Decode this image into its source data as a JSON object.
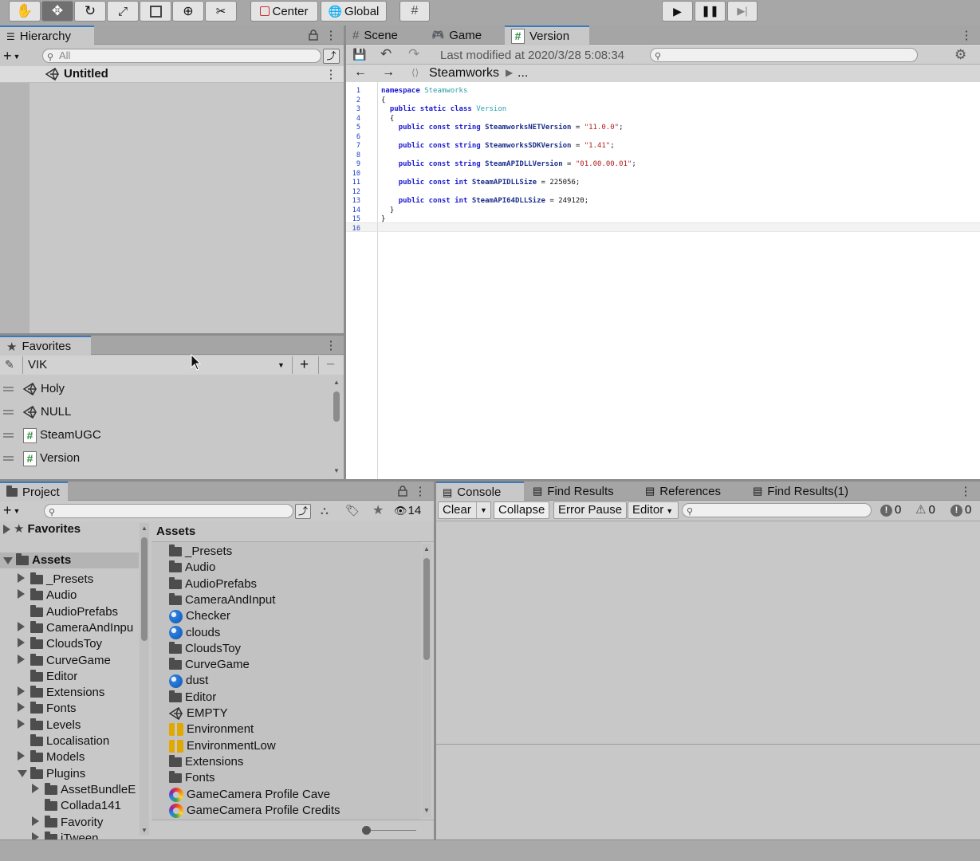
{
  "toolbar": {
    "center_label": "Center",
    "global_label": "Global"
  },
  "hierarchy": {
    "tab_label": "Hierarchy",
    "search_placeholder": "All",
    "scene_name": "Untitled"
  },
  "favorites_panel": {
    "tab_label": "Favorites",
    "dropdown_value": "VIK",
    "items": [
      {
        "label": "Holy",
        "icon": "unity-icon"
      },
      {
        "label": "NULL",
        "icon": "unity-icon"
      },
      {
        "label": "SteamUGC",
        "icon": "script-icon"
      },
      {
        "label": "Version",
        "icon": "script-icon"
      }
    ]
  },
  "editor": {
    "tabs": [
      {
        "label": "Scene",
        "icon": "grid-icon"
      },
      {
        "label": "Game",
        "icon": "gamepad-icon"
      },
      {
        "label": "Version",
        "icon": "script-icon"
      }
    ],
    "last_modified": "Last modified at 2020/3/28 5:08:34",
    "breadcrumb_namespace": "Steamworks",
    "breadcrumb_more": "...",
    "line_numbers": [
      "1",
      "2",
      "3",
      "4",
      "5",
      "6",
      "7",
      "8",
      "9",
      "10",
      "11",
      "12",
      "13",
      "14",
      "15",
      "16"
    ],
    "code_lines": [
      "namespace Steamworks",
      "{",
      "  public static class Version",
      "  {",
      "    public const string SteamworksNETVersion = \"11.0.0\";",
      "",
      "    public const string SteamworksSDKVersion = \"1.41\";",
      "",
      "    public const string SteamAPIDLLVersion = \"01.00.00.01\";",
      "",
      "    public const int SteamAPIDLLSize = 225056;",
      "",
      "    public const int SteamAPI64DLLSize = 249120;",
      "  }",
      "}",
      ""
    ]
  },
  "project": {
    "tab_label": "Project",
    "hidden_count": "14",
    "tree_favorites": "Favorites",
    "tree_assets": "Assets",
    "tree": [
      {
        "label": "_Presets",
        "expand": "right"
      },
      {
        "label": "Audio",
        "expand": "right"
      },
      {
        "label": "AudioPrefabs",
        "expand": ""
      },
      {
        "label": "CameraAndInpu",
        "expand": "right"
      },
      {
        "label": "CloudsToy",
        "expand": "right"
      },
      {
        "label": "CurveGame",
        "expand": "right"
      },
      {
        "label": "Editor",
        "expand": ""
      },
      {
        "label": "Extensions",
        "expand": "right"
      },
      {
        "label": "Fonts",
        "expand": "right"
      },
      {
        "label": "Levels",
        "expand": "right"
      },
      {
        "label": "Localisation",
        "expand": ""
      },
      {
        "label": "Models",
        "expand": "right"
      },
      {
        "label": "Plugins",
        "expand": "down"
      }
    ],
    "tree_plugins_children": [
      {
        "label": "AssetBundleE",
        "expand": "right"
      },
      {
        "label": "Collada141",
        "expand": ""
      },
      {
        "label": "Favority",
        "expand": "right"
      },
      {
        "label": "iTween",
        "expand": "right"
      }
    ],
    "assets_header": "Assets",
    "assets": [
      {
        "label": "_Presets",
        "icon": "folder"
      },
      {
        "label": "Audio",
        "icon": "folder"
      },
      {
        "label": "AudioPrefabs",
        "icon": "folder"
      },
      {
        "label": "CameraAndInput",
        "icon": "folder"
      },
      {
        "label": "Checker",
        "icon": "material"
      },
      {
        "label": "clouds",
        "icon": "material"
      },
      {
        "label": "CloudsToy",
        "icon": "folder"
      },
      {
        "label": "CurveGame",
        "icon": "folder"
      },
      {
        "label": "dust",
        "icon": "material"
      },
      {
        "label": "Editor",
        "icon": "folder"
      },
      {
        "label": "EMPTY",
        "icon": "unity"
      },
      {
        "label": "Environment",
        "icon": "lighting"
      },
      {
        "label": "EnvironmentLow",
        "icon": "lighting"
      },
      {
        "label": "Extensions",
        "icon": "folder"
      },
      {
        "label": "Fonts",
        "icon": "folder"
      },
      {
        "label": "GameCamera Profile Cave",
        "icon": "profile"
      },
      {
        "label": "GameCamera Profile Credits",
        "icon": "profile"
      }
    ]
  },
  "console": {
    "tabs": [
      {
        "label": "Console"
      },
      {
        "label": "Find Results"
      },
      {
        "label": "References"
      },
      {
        "label": "Find Results(1)"
      }
    ],
    "clear_label": "Clear",
    "collapse_label": "Collapse",
    "error_pause_label": "Error Pause",
    "editor_label": "Editor",
    "log_count": "0",
    "warning_count": "0",
    "error_count": "0"
  }
}
